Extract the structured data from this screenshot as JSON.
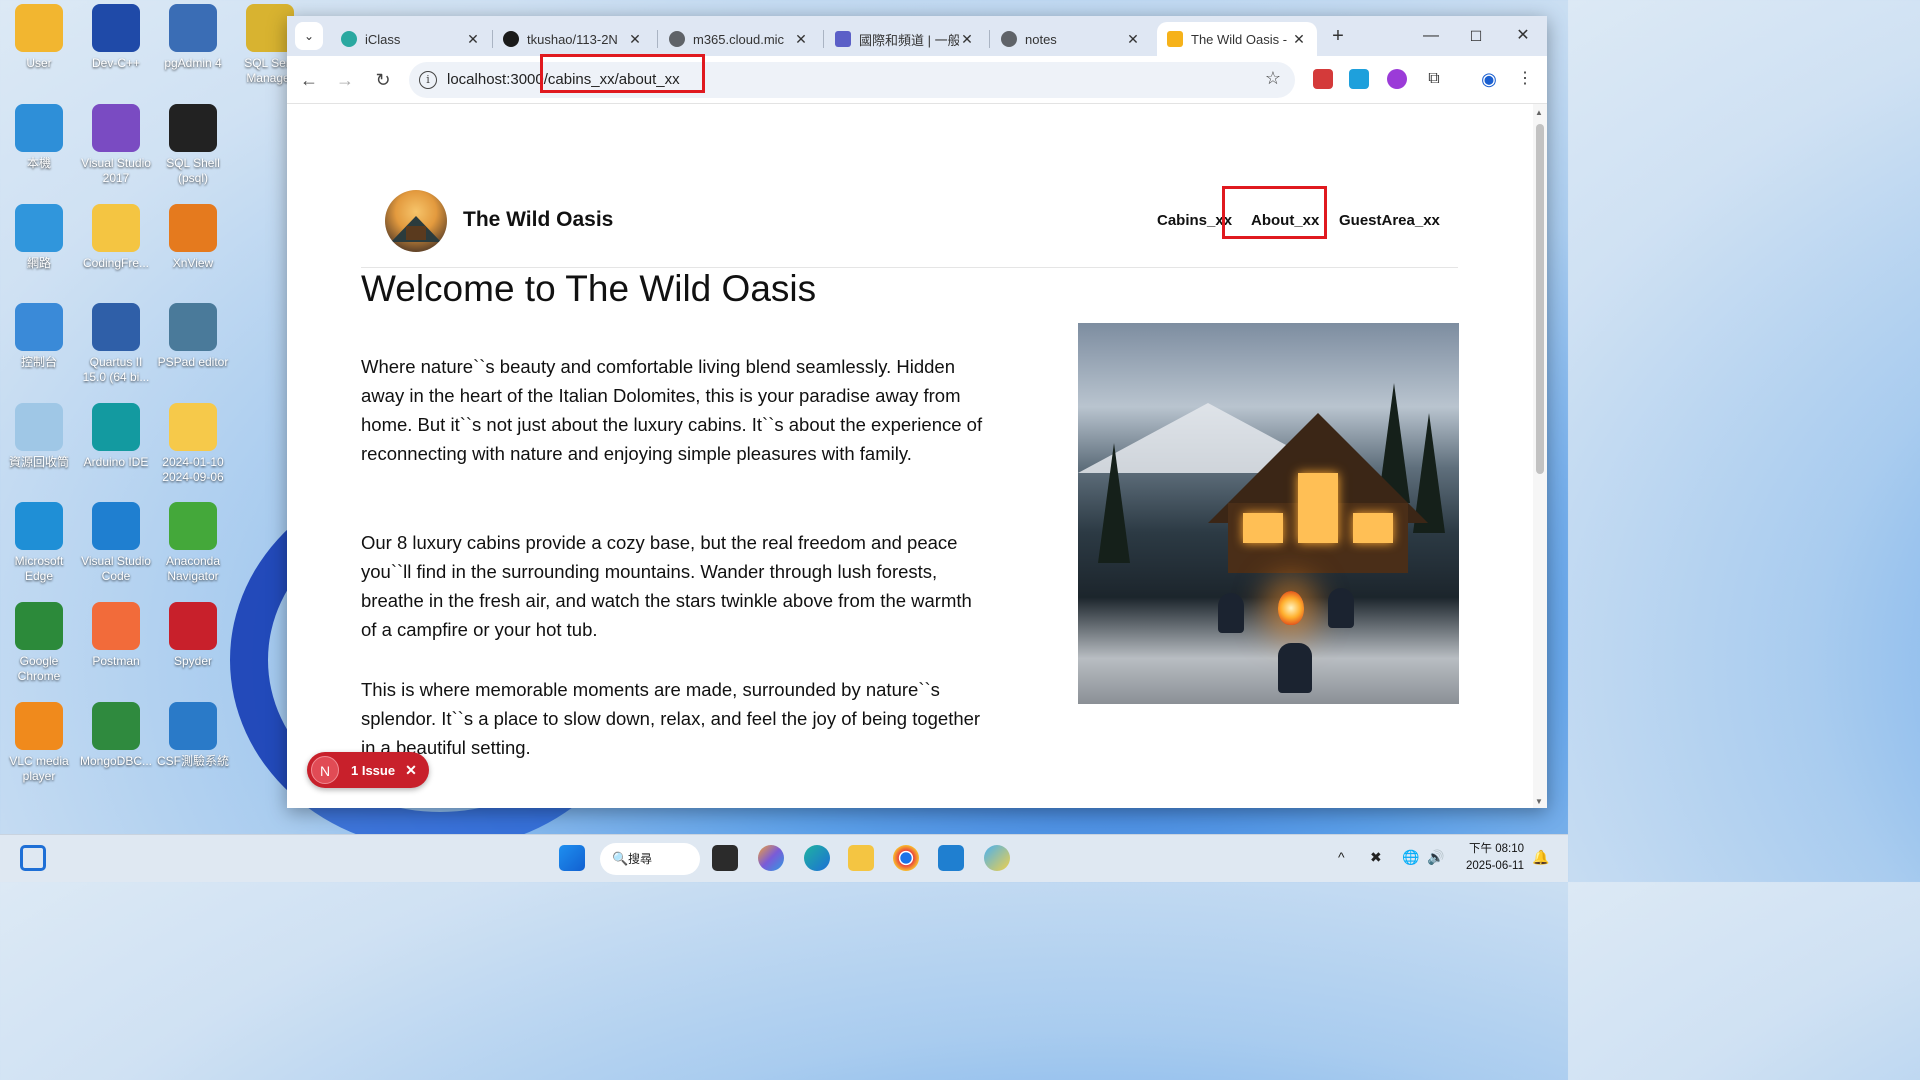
{
  "desktop": {
    "icons": [
      {
        "label": "User",
        "color": "#f2b630"
      },
      {
        "label": "Dev-C++",
        "color": "#1f4aa8"
      },
      {
        "label": "pgAdmin 4",
        "color": "#3a6db5"
      },
      {
        "label": "SQL Serv Manager",
        "color": "#d8b330"
      },
      {
        "label": "本機",
        "color": "#2e8fd8"
      },
      {
        "label": "Visual Studio 2017",
        "color": "#7a4bc2"
      },
      {
        "label": "SQL Shell (psql)",
        "color": "#222222"
      },
      {
        "label": "網路",
        "color": "#3096dc"
      },
      {
        "label": "CodingFre...",
        "color": "#f4c542"
      },
      {
        "label": "XnView",
        "color": "#e57a1e"
      },
      {
        "label": "控制台",
        "color": "#3a8ad8"
      },
      {
        "label": "Quartus II 15.0 (64 bi...",
        "color": "#2f5fa8"
      },
      {
        "label": "PSPad editor",
        "color": "#4a7a9a"
      },
      {
        "label": "資源回收筒",
        "color": "#9fc7e6"
      },
      {
        "label": "Arduino IDE",
        "color": "#139aa0"
      },
      {
        "label": "2024-01-10 2024-09-06",
        "color": "#f6c94a"
      },
      {
        "label": "Microsoft Edge",
        "color": "#1f8fd6"
      },
      {
        "label": "Visual Studio Code",
        "color": "#1f7fd0"
      },
      {
        "label": "Anaconda Navigator",
        "color": "#44a83a"
      },
      {
        "label": "Google Chrome",
        "color": "#2c8a3a"
      },
      {
        "label": "Postman",
        "color": "#f26b3a"
      },
      {
        "label": "Spyder",
        "color": "#c8202b"
      },
      {
        "label": "VLC media player",
        "color": "#f08a1c"
      },
      {
        "label": "MongoDBC...",
        "color": "#2f8a3e"
      },
      {
        "label": "CSF測驗系統",
        "color": "#2a7ac8"
      }
    ]
  },
  "browser": {
    "tabs": [
      {
        "title": "iClass",
        "icon_color": "#2aa8a0"
      },
      {
        "title": "tkushao/113-2N",
        "icon_color": "#1a1a1a"
      },
      {
        "title": "m365.cloud.mic",
        "icon_color": "#5f6368"
      },
      {
        "title": "國際和頻道 | 一般",
        "icon_color": "#5b5fc7"
      },
      {
        "title": "notes",
        "icon_color": "#5f6368"
      },
      {
        "title": "The Wild Oasis -",
        "icon_color": "#f6b21a"
      }
    ],
    "new_tab_glyph": "+",
    "url": "localhost:3000/cabins_xx/about_xx"
  },
  "page": {
    "brand": "The Wild Oasis",
    "nav": {
      "cabins": "Cabins_xx",
      "about": "About_xx",
      "guest": "GuestArea_xx"
    },
    "title": "Welcome to The Wild Oasis",
    "paragraphs": [
      "Where nature``s beauty and comfortable living blend seamlessly. Hidden away in the heart of the Italian Dolomites, this is your paradise away from home. But it``s not just about the luxury cabins. It``s about the experience of reconnecting with nature and enjoying simple pleasures with family.",
      "Our 8 luxury cabins provide a cozy base, but the real freedom and peace you``ll find in the surrounding mountains. Wander through lush forests, breathe in the fresh air, and watch the stars twinkle above from the warmth of a campfire or your hot tub.",
      "This is where memorable moments are made, surrounded by nature``s splendor. It``s a place to slow down, relax, and feel the joy of being together in a beautiful setting."
    ],
    "issue_badge": {
      "initial": "N",
      "label": "1 Issue"
    }
  },
  "taskbar": {
    "search_label": "搜尋",
    "clock_time": "下午 08:10",
    "clock_date": "2025-06-11"
  },
  "colors": {
    "highlight_box": "#e0191f",
    "issue_badge": "#c8202b"
  }
}
